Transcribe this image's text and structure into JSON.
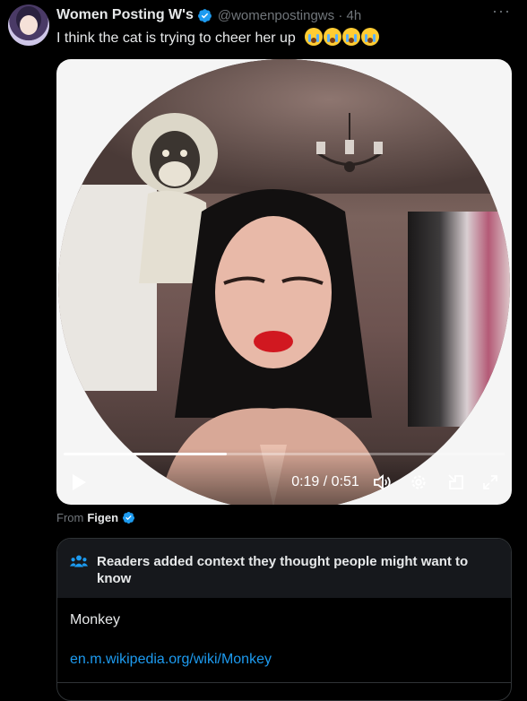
{
  "tweet": {
    "author_name": "Women Posting W's",
    "handle": "@womenpostingws",
    "separator": "·",
    "time": "4h",
    "more": "···",
    "text": "I think the cat is trying to cheer her up",
    "emoji_count": 4
  },
  "video": {
    "time_current": "0:19",
    "time_total": "0:51",
    "time_display": "0:19 / 0:51",
    "progress": 0.37,
    "icons": [
      "play-icon",
      "volume-icon",
      "settings-icon",
      "pip-icon",
      "fullscreen-icon"
    ]
  },
  "attribution": {
    "prefix": "From",
    "source": "Figen"
  },
  "community_note": {
    "title": "Readers added context they thought people might want to know",
    "body": "Monkey",
    "link": "en.m.wikipedia.org/wiki/Monkey"
  },
  "colors": {
    "background": "#000000",
    "text": "#e7e9ea",
    "muted": "#71767b",
    "accent": "#1d9bf0"
  }
}
